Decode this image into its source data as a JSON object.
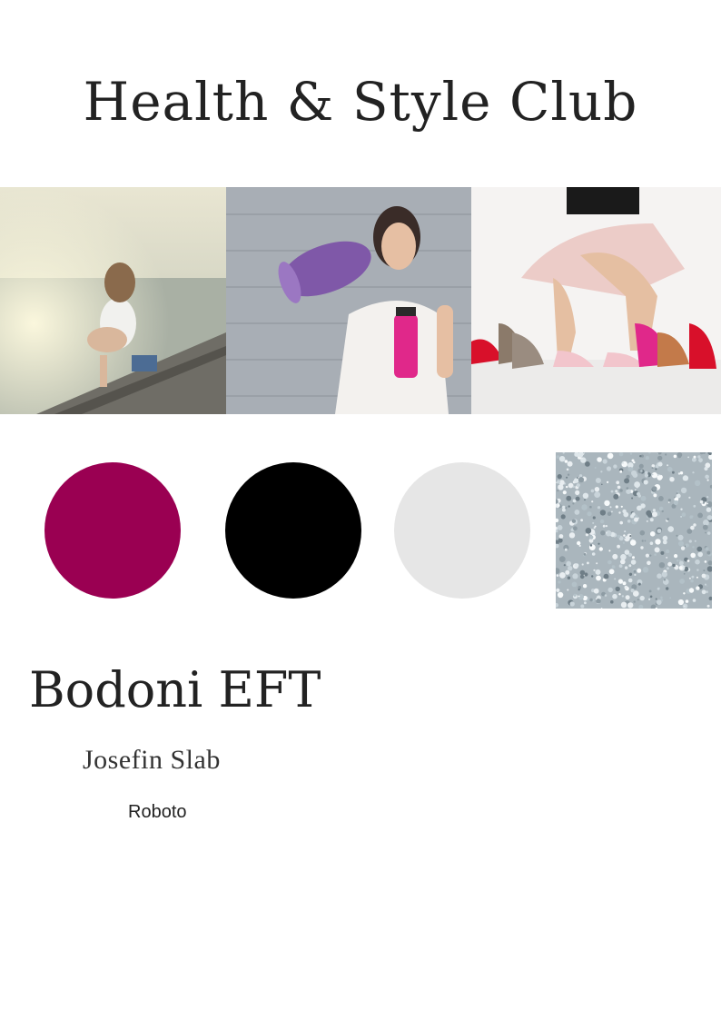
{
  "header": {
    "title": "Health & Style Club"
  },
  "photos": [
    {
      "icon": "woman-on-pier-photo"
    },
    {
      "icon": "woman-with-yoga-mat-photo"
    },
    {
      "icon": "woman-with-heels-photo"
    }
  ],
  "palette": {
    "colors": [
      "#9a0052",
      "#000000",
      "#e6e6e6"
    ],
    "texture": "silver-glitter-texture"
  },
  "typography": {
    "heading_font": "Bodoni EFT",
    "subheading_font": "Josefin Slab",
    "body_font": "Roboto"
  }
}
